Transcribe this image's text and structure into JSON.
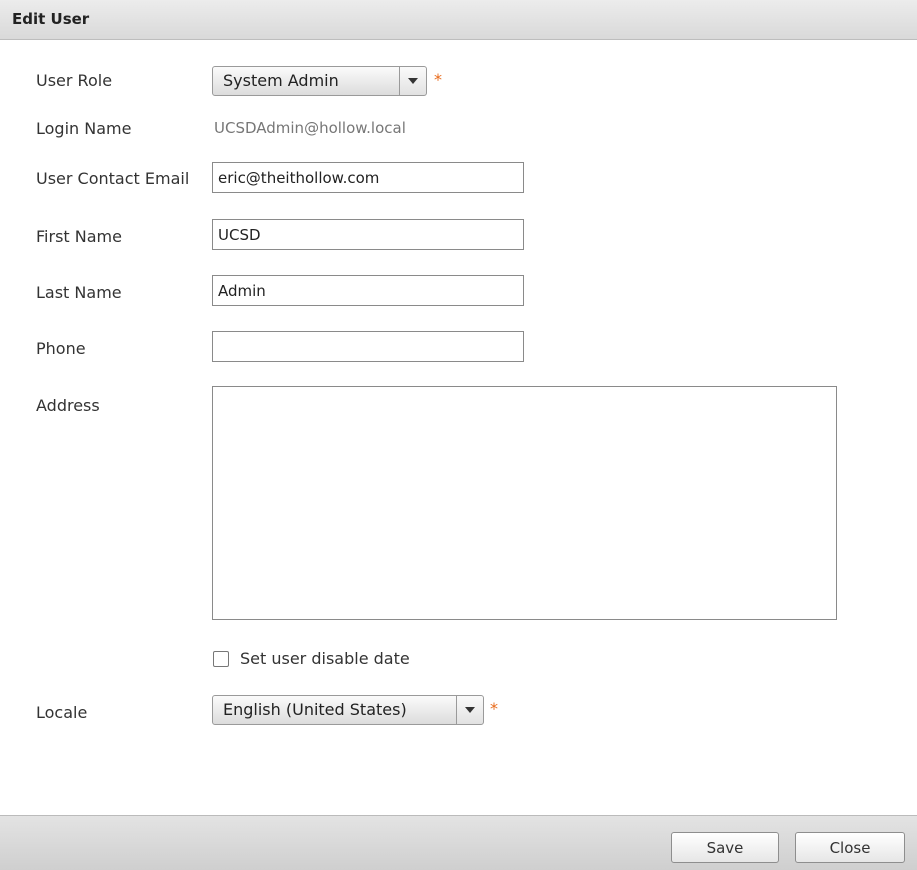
{
  "dialog": {
    "title": "Edit User"
  },
  "form": {
    "user_role": {
      "label": "User Role",
      "value": "System Admin",
      "required_mark": "*"
    },
    "login_name": {
      "label": "Login Name",
      "value": "UCSDAdmin@hollow.local"
    },
    "contact_email": {
      "label": "User Contact Email",
      "value": "eric@theithollow.com"
    },
    "first_name": {
      "label": "First Name",
      "value": "UCSD"
    },
    "last_name": {
      "label": "Last Name",
      "value": "Admin"
    },
    "phone": {
      "label": "Phone",
      "value": ""
    },
    "address": {
      "label": "Address",
      "value": ""
    },
    "disable_date": {
      "label": "Set user disable date",
      "checked": false
    },
    "locale": {
      "label": "Locale",
      "value": "English (United States)",
      "required_mark": "*"
    }
  },
  "footer": {
    "save_label": "Save",
    "close_label": "Close"
  },
  "colors": {
    "required": "#e86a1a",
    "header_bg": "#dcdcdc"
  },
  "icons": {
    "dropdown": "chevron-down-icon",
    "required": "asterisk-icon"
  }
}
